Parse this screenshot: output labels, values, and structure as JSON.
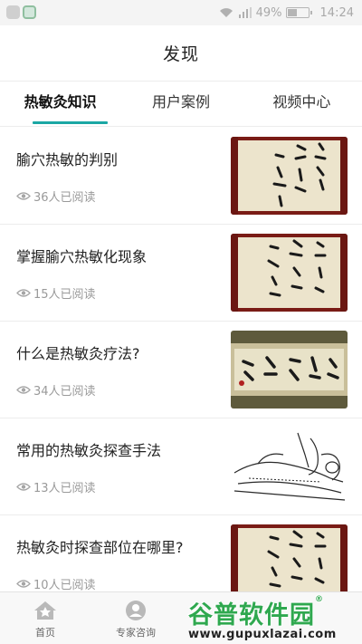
{
  "status_bar": {
    "battery": "49%",
    "battery_level": 0.49,
    "time": "14:24"
  },
  "header": {
    "title": "发现"
  },
  "tabs": [
    {
      "label": "热敏灸知识",
      "active": true
    },
    {
      "label": "用户案例",
      "active": false
    },
    {
      "label": "视频中心",
      "active": false
    }
  ],
  "articles": [
    {
      "title": "腧穴热敏的判别",
      "reads": "36人已阅读",
      "thumb": "calligraphy-scroll"
    },
    {
      "title": "掌握腧穴热敏化现象",
      "reads": "15人已阅读",
      "thumb": "calligraphy-scroll"
    },
    {
      "title": "什么是热敏灸疗法?",
      "reads": "34人已阅读",
      "thumb": "calligraphy-banner"
    },
    {
      "title": "常用的热敏灸探查手法",
      "reads": "13人已阅读",
      "thumb": "sketch-illustration"
    },
    {
      "title": "热敏灸时探查部位在哪里?",
      "reads": "10人已阅读",
      "thumb": "calligraphy-scroll"
    }
  ],
  "bottom_nav": [
    {
      "label": "首页",
      "icon": "home-icon"
    },
    {
      "label": "专家咨询",
      "icon": "expert-icon"
    }
  ],
  "watermark": {
    "brand": "谷普软件园",
    "url": "www.gupuxlazai.com"
  },
  "colors": {
    "accent": "#1ba7a4",
    "watermark_green": "#2fa84f"
  }
}
